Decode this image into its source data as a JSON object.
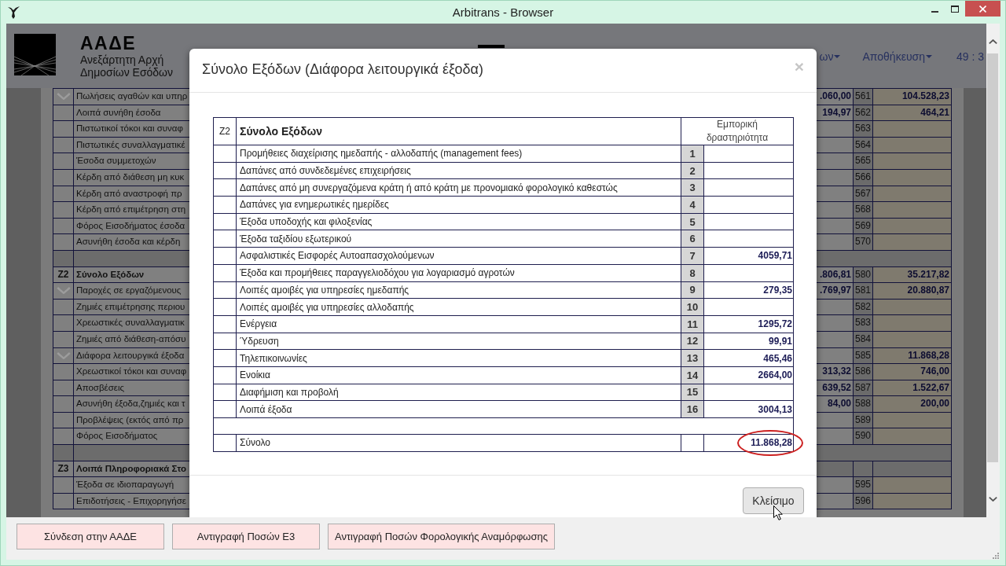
{
  "window": {
    "title": "Arbitrans - Browser"
  },
  "page_header": {
    "logo_title": "ΑΑΔΕ",
    "logo_lines": [
      "Ανεξάρτητη Αρχή",
      "Δημοσίων Εσόδων"
    ],
    "menu": [
      {
        "label": "ων",
        "dropdown": true
      },
      {
        "label": "Αποθήκευση",
        "dropdown": true
      }
    ],
    "timer": "49 : 3"
  },
  "sheet": {
    "rows": [
      {
        "kind": "item",
        "expanded": true,
        "label": "Πωλήσεις αγαθών και υπηρ",
        "value_1": ".060,00",
        "line": "561",
        "value_2": "104.528,23"
      },
      {
        "kind": "item",
        "expanded": false,
        "label": "Λοιπά συνήθη έσοδα",
        "value_1": "194,97",
        "line": "562",
        "value_2": "464,21"
      },
      {
        "kind": "item",
        "expanded": false,
        "label": "Πιστωτικοί τόκοι και συναφ",
        "line": "563"
      },
      {
        "kind": "item",
        "expanded": false,
        "label": "Πιστωτικές συναλλαγματικέ",
        "line": "564"
      },
      {
        "kind": "item",
        "expanded": false,
        "label": "Έσοδα συμμετοχών",
        "line": "565"
      },
      {
        "kind": "item",
        "expanded": false,
        "label": "Κέρδη από διάθεση μη κυκ",
        "line": "566"
      },
      {
        "kind": "item",
        "expanded": false,
        "label": "Κέρδη από αναστροφή πρ",
        "line": "567"
      },
      {
        "kind": "item",
        "expanded": false,
        "label": "Κέρδη από επιμέτρηση στη",
        "line": "568"
      },
      {
        "kind": "item",
        "expanded": false,
        "label": "Φόρος Εισοδήματος έσοδα",
        "line": "569"
      },
      {
        "kind": "item",
        "expanded": false,
        "label": "Ασυνήθη έσοδα και κέρδη",
        "line": "570"
      },
      {
        "kind": "spacer"
      },
      {
        "kind": "total",
        "code": "Z2",
        "label": "Σύνολο Εξόδων",
        "value_1": ".806,81",
        "line": "580",
        "value_2": "35.217,82"
      },
      {
        "kind": "item",
        "expanded": true,
        "label": "Παροχές σε εργαζόμενους",
        "value_1": ".769,97",
        "line": "581",
        "value_2": "20.880,87"
      },
      {
        "kind": "item",
        "expanded": false,
        "label": "Ζημιές επιμέτρησης περιου",
        "line": "582"
      },
      {
        "kind": "item",
        "expanded": false,
        "label": "Χρεωστικές συναλλαγματικ",
        "line": "583"
      },
      {
        "kind": "item",
        "expanded": false,
        "label": "Ζημιές από διάθεση-απόσυ",
        "line": "584"
      },
      {
        "kind": "item",
        "expanded": true,
        "label": "Διάφορα λειτουργικά έξοδα",
        "line": "585",
        "value_2": "11.868,28"
      },
      {
        "kind": "item",
        "expanded": false,
        "label": "Χρεωστικοί τόκοι και συναφ",
        "value_1": "313,32",
        "line": "586",
        "value_2": "746,00"
      },
      {
        "kind": "item",
        "expanded": false,
        "label": "Αποσβέσεις",
        "value_1": "639,52",
        "line": "587",
        "value_2": "1.522,67"
      },
      {
        "kind": "item",
        "expanded": false,
        "label": "Ασυνήθη έξοδα,ζημιές και τ",
        "value_1": "84,00",
        "line": "588",
        "value_2": "200,00"
      },
      {
        "kind": "item",
        "expanded": false,
        "label": "Προβλέψεις (εκτός από πρ",
        "line": "589"
      },
      {
        "kind": "item",
        "expanded": false,
        "label": "Φόρος Εισοδήματος",
        "line": "590"
      },
      {
        "kind": "spacer"
      },
      {
        "kind": "heading",
        "code": "Z3",
        "label": "Λοιπά Πληροφοριακά Στο"
      },
      {
        "kind": "item",
        "expanded": false,
        "label": "Έξοδα σε ιδιοπαραγωγή",
        "line": "595"
      },
      {
        "kind": "item",
        "expanded": false,
        "label": "Επιδοτήσεις - Επιχορηγήσε",
        "line": "596"
      }
    ]
  },
  "modal": {
    "title": "Σύνολο Εξόδων (Διάφορα λειτουργικά έξοδα)",
    "close": "×",
    "table": {
      "code": "Z2",
      "heading": "Σύνολο Εξόδων",
      "column": "Εμπορική δραστηριότητα",
      "rows": [
        {
          "label": "Προμήθειες διαχείρισης ημεδαπής - αλλοδαπής (management fees)",
          "line": "1"
        },
        {
          "label": "Δαπάνες από συνδεδεμένες επιχειρήσεις",
          "line": "2"
        },
        {
          "label": "Δαπάνες από μη συνεργαζόμενα κράτη ή από κράτη με προνομιακό φορολογικό καθεστώς",
          "line": "3"
        },
        {
          "label": "Δαπάνες για ενημερωτικές ημερίδες",
          "line": "4"
        },
        {
          "label": "Έξοδα υποδοχής και φιλοξενίας",
          "line": "5"
        },
        {
          "label": "Έξοδα ταξιδίου εξωτερικού",
          "line": "6"
        },
        {
          "label": "Ασφαλιστικές Εισφορές Αυτοαπασχολούμενων",
          "line": "7",
          "value": "4059,71"
        },
        {
          "label": "Έξοδα και προμήθειες παραγγελιοδόχου για λογαριασμό αγροτών",
          "line": "8"
        },
        {
          "label": "Λοιπές αμοιβές για υπηρεσίες ημεδαπής",
          "line": "9",
          "value": "279,35"
        },
        {
          "label": "Λοιπές αμοιβές για υπηρεσίες αλλοδαπής",
          "line": "10"
        },
        {
          "label": "Ενέργεια",
          "line": "11",
          "value": "1295,72"
        },
        {
          "label": "Ύδρευση",
          "line": "12",
          "value": "99,91"
        },
        {
          "label": "Τηλεπικοινωνίες",
          "line": "13",
          "value": "465,46"
        },
        {
          "label": "Ενοίκια",
          "line": "14",
          "value": "2664,00"
        },
        {
          "label": "Διαφήμιση και προβολή",
          "line": "15"
        },
        {
          "label": "Λοιπά έξοδα",
          "line": "16",
          "value": "3004,13"
        }
      ],
      "total": {
        "label": "Σύνολο",
        "value": "11.868,28",
        "highlighted": true
      }
    },
    "buttons": [
      {
        "label": "Κλείσιμο",
        "hovered": true
      }
    ]
  },
  "toolbar": {
    "buttons": [
      "Σύνδεση στην ΑΑΔΕ",
      "Αντιγραφή Ποσών Ε3",
      "Αντιγραφή Ποσών Φορολογικής Αναμόρφωσης"
    ]
  }
}
